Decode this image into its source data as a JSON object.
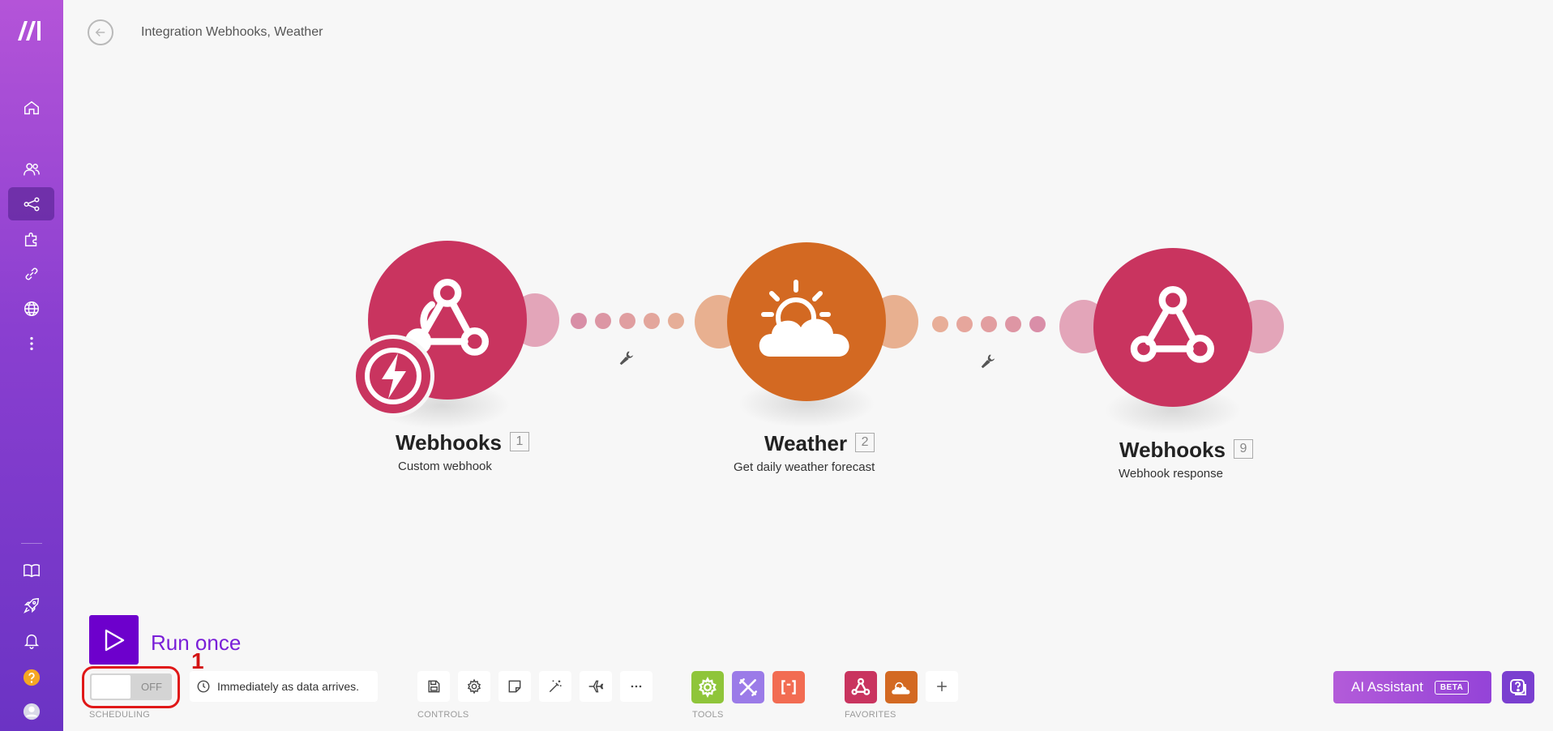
{
  "header": {
    "title": "Integration Webhooks, Weather"
  },
  "modules": [
    {
      "name": "Webhooks",
      "number": "1",
      "subtitle": "Custom webhook",
      "color": "#c9345f",
      "icon": "webhook-icon",
      "trigger_icon": "instant-trigger-icon"
    },
    {
      "name": "Weather",
      "number": "2",
      "subtitle": "Get daily weather forecast",
      "color": "#d36922",
      "icon": "weather-sun-cloud-icon"
    },
    {
      "name": "Webhooks",
      "number": "9",
      "subtitle": "Webhook response",
      "color": "#c9345f",
      "icon": "webhook-icon"
    }
  ],
  "run": {
    "label": "Run once"
  },
  "annotation": {
    "label": "1"
  },
  "scheduling": {
    "toggle_state": "OFF",
    "schedule_text": "Immediately as data arrives.",
    "group_label": "SCHEDULING"
  },
  "controls": {
    "group_label": "CONTROLS",
    "buttons": [
      "save-icon",
      "gear-icon",
      "note-icon",
      "magic-wand-icon",
      "airplane-icon",
      "ellipsis-icon"
    ]
  },
  "tools": {
    "group_label": "TOOLS",
    "items": [
      {
        "icon": "gear-icon",
        "color": "#8fc53a"
      },
      {
        "icon": "tools-icon",
        "color": "#9b7be8"
      },
      {
        "icon": "brackets-icon",
        "color": "#f26c52"
      }
    ]
  },
  "favorites": {
    "group_label": "FAVORITES",
    "items": [
      {
        "icon": "webhook-icon",
        "color": "#c9345f"
      },
      {
        "icon": "weather-sun-cloud-icon",
        "color": "#d36922"
      }
    ]
  },
  "ai_assistant": {
    "label": "AI Assistant",
    "badge": "BETA"
  },
  "sidebar": {
    "items": [
      "home-icon",
      "team-icon",
      "scenarios-icon",
      "puzzle-icon",
      "link-icon",
      "globe-icon",
      "more-vertical-icon",
      "book-icon",
      "rocket-icon",
      "bell-icon",
      "help-icon",
      "avatar-icon"
    ]
  }
}
